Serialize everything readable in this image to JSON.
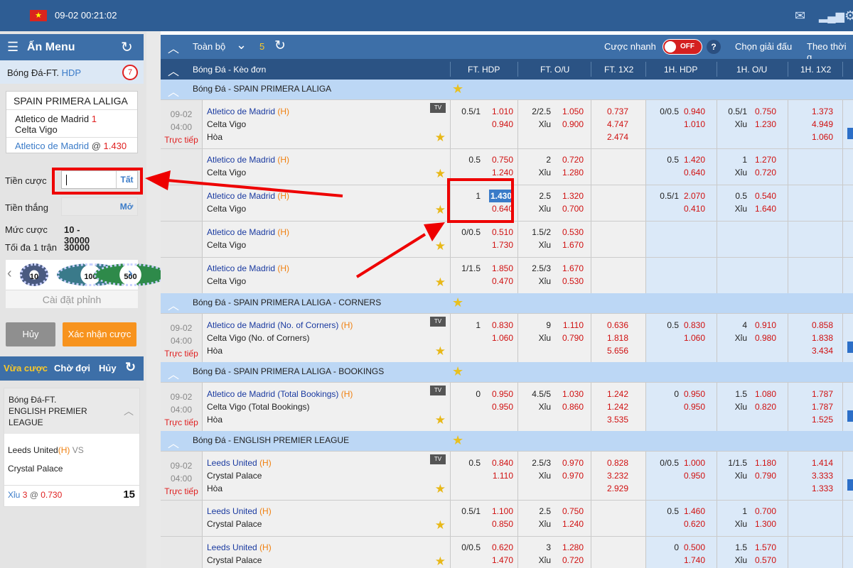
{
  "topbar": {
    "flag": "★",
    "datetime": "09-02 00:21:02"
  },
  "left": {
    "menu_title": "Ấn Menu",
    "bet_type": "Bóng Đá-FT.",
    "bet_type_hdp": "HDP",
    "badge_count": "7",
    "slip": {
      "league": "SPAIN PRIMERA LALIGA",
      "home": "Atletico de Madrid",
      "home_hdp": "1",
      "away": "Celta Vigo",
      "pick": "Atletico de Madrid",
      "pick_at": "@",
      "pick_odds": "1.430"
    },
    "stake_label": "Tiền cược",
    "stake_btn": "Tất",
    "win_label": "Tiền thắng",
    "win_btn": "Mở",
    "limit_label": "Mức cược",
    "limit_value": "10 - 30000",
    "max_label": "Tối đa 1 trận",
    "max_value": "30000",
    "chips": [
      "10",
      "100",
      "500"
    ],
    "chip_setting": "Cài đặt phỉnh",
    "cancel": "Hủy",
    "confirm": "Xác nhận cược",
    "tabs": [
      "Vừa cược",
      "Chờ đợi",
      "Hủy"
    ],
    "card": {
      "l1": "Bóng Đá-FT.",
      "l2": "ENGLISH PREMIER",
      "l3": "LEAGUE",
      "home": "Leeds United",
      "home_tag": "(H)",
      "vs": "VS",
      "away": "Crystal Palace",
      "pick": "Xỉu",
      "line": "3",
      "at": "@",
      "odds": "0.730",
      "count": "15"
    }
  },
  "toolbar": {
    "all": "Toàn bộ",
    "count": "5",
    "quick": "Cược nhanh",
    "toggle": "OFF",
    "help": "?",
    "pick_league": "Chọn giải đấu",
    "by_time": "Theo thời g"
  },
  "header": {
    "sport": "Bóng Đá - Kèo đơn",
    "cols": [
      "FT. HDP",
      "FT. O/U",
      "FT. 1X2",
      "1H. HDP",
      "1H. O/U",
      "1H. 1X2"
    ]
  },
  "leagues": [
    {
      "name": "Bóng Đá - SPAIN PRIMERA LALIGA",
      "rows": [
        {
          "date": "09-02",
          "time": "04:00",
          "live": "Trực tiếp",
          "home": "Atletico de Madrid",
          "tag": "(H)",
          "away": "Celta Vigo",
          "draw": "Hòa",
          "hdp": "0.5/1",
          "h1": "1.010",
          "h2": "0.940",
          "ou": "2/2.5",
          "ou_lbl": "Xỉu",
          "o1": "1.050",
          "o2": "0.900",
          "x1": "0.737",
          "x2": "4.747",
          "x3": "2.474",
          "hh": "0/0.5",
          "hh1": "0.940",
          "hh2": "1.010",
          "ho": "0.5/1",
          "ho_lbl": "Xỉu",
          "ho1": "0.750",
          "ho2": "1.230",
          "hx1": "1.373",
          "hx2": "4.949",
          "hx3": "1.060"
        },
        {
          "home": "Atletico de Madrid",
          "tag": "(H)",
          "away": "Celta Vigo",
          "hdp": "0.5",
          "h1": "0.750",
          "h2": "1.240",
          "ou": "2",
          "ou_lbl": "Xỉu",
          "o1": "0.720",
          "o2": "1.280",
          "hh": "0.5",
          "hh1": "1.420",
          "hh2": "0.640",
          "ho": "1",
          "ho_lbl": "Xỉu",
          "ho1": "1.270",
          "ho2": "0.720"
        },
        {
          "home": "Atletico de Madrid",
          "tag": "(H)",
          "away": "Celta Vigo",
          "hdp": "1",
          "h1": "1.430",
          "h2": "0.640",
          "ou": "2.5",
          "ou_lbl": "Xỉu",
          "o1": "1.320",
          "o2": "0.700",
          "hh": "0.5/1",
          "hh1": "2.070",
          "hh2": "0.410",
          "ho": "0.5",
          "ho_lbl": "Xỉu",
          "ho1": "0.540",
          "ho2": "1.640"
        },
        {
          "home": "Atletico de Madrid",
          "tag": "(H)",
          "away": "Celta Vigo",
          "hdp": "0/0.5",
          "h1": "0.510",
          "h2": "1.730",
          "ou": "1.5/2",
          "ou_lbl": "Xỉu",
          "o1": "0.530",
          "o2": "1.670"
        },
        {
          "home": "Atletico de Madrid",
          "tag": "(H)",
          "away": "Celta Vigo",
          "hdp": "1/1.5",
          "h1": "1.850",
          "h2": "0.470",
          "ou": "2.5/3",
          "ou_lbl": "Xỉu",
          "o1": "1.670",
          "o2": "0.530"
        }
      ]
    },
    {
      "name": "Bóng Đá - SPAIN PRIMERA LALIGA - CORNERS",
      "rows": [
        {
          "date": "09-02",
          "time": "04:00",
          "live": "Trực tiếp",
          "home": "Atletico de Madrid (No. of Corners)",
          "tag": "(H)",
          "away": "Celta Vigo (No. of Corners)",
          "draw": "Hòa",
          "hdp": "1",
          "h1": "0.830",
          "h2": "1.060",
          "ou": "9",
          "ou_lbl": "Xỉu",
          "o1": "1.110",
          "o2": "0.790",
          "x1": "0.636",
          "x2": "1.818",
          "x3": "5.656",
          "hh": "0.5",
          "hh1": "0.830",
          "hh2": "1.060",
          "ho": "4",
          "ho_lbl": "Xỉu",
          "ho1": "0.910",
          "ho2": "0.980",
          "hx1": "0.858",
          "hx2": "1.838",
          "hx3": "3.434"
        }
      ]
    },
    {
      "name": "Bóng Đá - SPAIN PRIMERA LALIGA - BOOKINGS",
      "rows": [
        {
          "date": "09-02",
          "time": "04:00",
          "live": "Trực tiếp",
          "home": "Atletico de Madrid (Total Bookings)",
          "tag": "(H)",
          "away": "Celta Vigo (Total Bookings)",
          "draw": "Hòa",
          "hdp": "0",
          "h1": "0.950",
          "h2": "0.950",
          "ou": "4.5/5",
          "ou_lbl": "Xỉu",
          "o1": "1.030",
          "o2": "0.860",
          "x1": "1.242",
          "x2": "1.242",
          "x3": "3.535",
          "hh": "0",
          "hh1": "0.950",
          "hh2": "0.950",
          "ho": "1.5",
          "ho_lbl": "Xỉu",
          "ho1": "1.080",
          "ho2": "0.820",
          "hx1": "1.787",
          "hx2": "1.787",
          "hx3": "1.525"
        }
      ]
    },
    {
      "name": "Bóng Đá - ENGLISH PREMIER LEAGUE",
      "rows": [
        {
          "date": "09-02",
          "time": "04:00",
          "live": "Trực tiếp",
          "home": "Leeds United",
          "tag": "(H)",
          "away": "Crystal Palace",
          "draw": "Hòa",
          "hdp": "0.5",
          "h1": "0.840",
          "h2": "1.110",
          "ou": "2.5/3",
          "ou_lbl": "Xỉu",
          "o1": "0.970",
          "o2": "0.970",
          "x1": "0.828",
          "x2": "3.232",
          "x3": "2.929",
          "hh": "0/0.5",
          "hh1": "1.000",
          "hh2": "0.950",
          "ho": "1/1.5",
          "ho_lbl": "Xỉu",
          "ho1": "1.180",
          "ho2": "0.790",
          "hx1": "1.414",
          "hx2": "3.333",
          "hx3": "1.333"
        },
        {
          "home": "Leeds United",
          "tag": "(H)",
          "away": "Crystal Palace",
          "hdp": "0.5/1",
          "h1": "1.100",
          "h2": "0.850",
          "ou": "2.5",
          "ou_lbl": "Xỉu",
          "o1": "0.750",
          "o2": "1.240",
          "hh": "0.5",
          "hh1": "1.460",
          "hh2": "0.620",
          "ho": "1",
          "ho_lbl": "Xỉu",
          "ho1": "0.700",
          "ho2": "1.300"
        },
        {
          "home": "Leeds United",
          "tag": "(H)",
          "away": "Crystal Palace",
          "hdp": "0/0.5",
          "h1": "0.620",
          "h2": "1.470",
          "ou": "3",
          "ou_lbl": "Xỉu",
          "o1": "1.280",
          "o2": "0.720",
          "hh": "0",
          "hh1": "0.500",
          "hh2": "1.740",
          "ho": "1.5",
          "ho_lbl": "Xỉu",
          "ho1": "1.570",
          "ho2": "0.570"
        }
      ]
    }
  ]
}
